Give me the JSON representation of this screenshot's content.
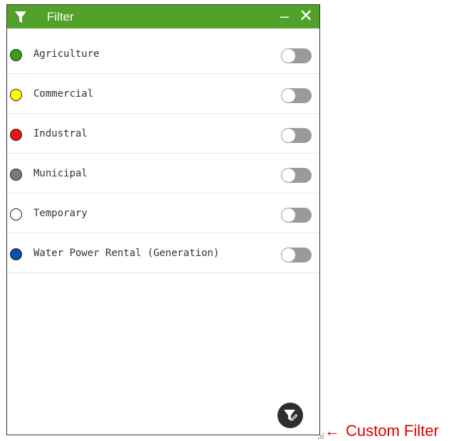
{
  "colors": {
    "titlebar": "#52a12a",
    "toggle_off": "#9a9a9a",
    "annotation": "#e00000",
    "custom_filter_button": "#2e2e2e"
  },
  "window": {
    "title": "Filter",
    "title_icon": "filter-icon",
    "minimize_label": "–",
    "close_label": "✕"
  },
  "filters": [
    {
      "label": "Agriculture",
      "color": "#3aa019",
      "enabled": false
    },
    {
      "label": "Commercial",
      "color": "#ffff00",
      "enabled": false
    },
    {
      "label": "Industral",
      "color": "#ee1111",
      "enabled": false
    },
    {
      "label": "Municipal",
      "color": "#7a7a7a",
      "enabled": false
    },
    {
      "label": "Temporary",
      "color": "#ffffff",
      "enabled": false
    },
    {
      "label": "Water Power Rental (Generation)",
      "color": "#0a4fa8",
      "enabled": false
    }
  ],
  "custom_filter_button": {
    "icon": "filter-edit-icon"
  },
  "annotation": {
    "arrow": "←",
    "text": "Custom Filter"
  }
}
